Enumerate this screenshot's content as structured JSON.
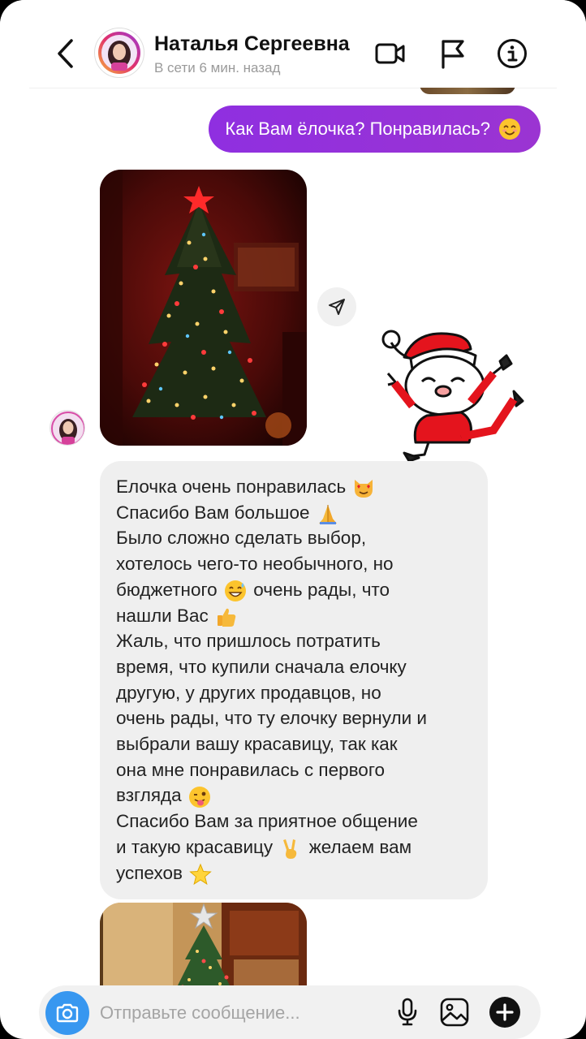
{
  "header": {
    "contact_name": "Наталья Сергеевна",
    "status": "В сети 6 мин. назад"
  },
  "icons": {
    "back": "chevron-left-icon",
    "video": "video-camera-icon",
    "report": "flag-icon",
    "info": "info-icon",
    "share": "paper-plane-icon",
    "camera": "camera-icon",
    "mic": "microphone-icon",
    "gallery": "image-icon",
    "add": "plus-icon"
  },
  "colors": {
    "outgoing_bubble": "#9334d9",
    "incoming_bubble": "#efefef",
    "camera_button": "#3797f0"
  },
  "messages": {
    "outgoing": {
      "text": "Как Вам ёлочка? Понравилась?",
      "emoji": "smiling-face"
    },
    "incoming_lines": [
      {
        "text": "Елочка очень понравилась",
        "emoji": "heart-eyes-cat"
      },
      {
        "text": "Спасибо Вам большое",
        "emoji": "folded-hands"
      },
      {
        "text": "Было сложно сделать выбор,",
        "emoji": ""
      },
      {
        "text": "хотелось чего-то необычного, но",
        "emoji": ""
      },
      {
        "text": "бюджетного",
        "emoji": "grinning-sweat",
        "after": "очень рады, что"
      },
      {
        "text": "нашли Вас",
        "emoji": "thumbs-up"
      },
      {
        "text": "Жаль, что пришлось потратить",
        "emoji": ""
      },
      {
        "text": "время, что купили сначала елочку",
        "emoji": ""
      },
      {
        "text": "другую, у других продавцов, но",
        "emoji": ""
      },
      {
        "text": "очень рады, что ту елочку вернули и",
        "emoji": ""
      },
      {
        "text": "выбрали вашу красавицу, так как",
        "emoji": ""
      },
      {
        "text": "она мне понравилась с первого",
        "emoji": ""
      },
      {
        "text": "взгляда",
        "emoji": "winking-tongue"
      },
      {
        "text": "Спасибо Вам за приятное общение",
        "emoji": ""
      },
      {
        "text": "и такую красавицу",
        "emoji": "victory-hand",
        "after": "желаем вам"
      },
      {
        "text": "успехов",
        "emoji": "star"
      }
    ]
  },
  "composer": {
    "placeholder": "Отправьте сообщение..."
  }
}
